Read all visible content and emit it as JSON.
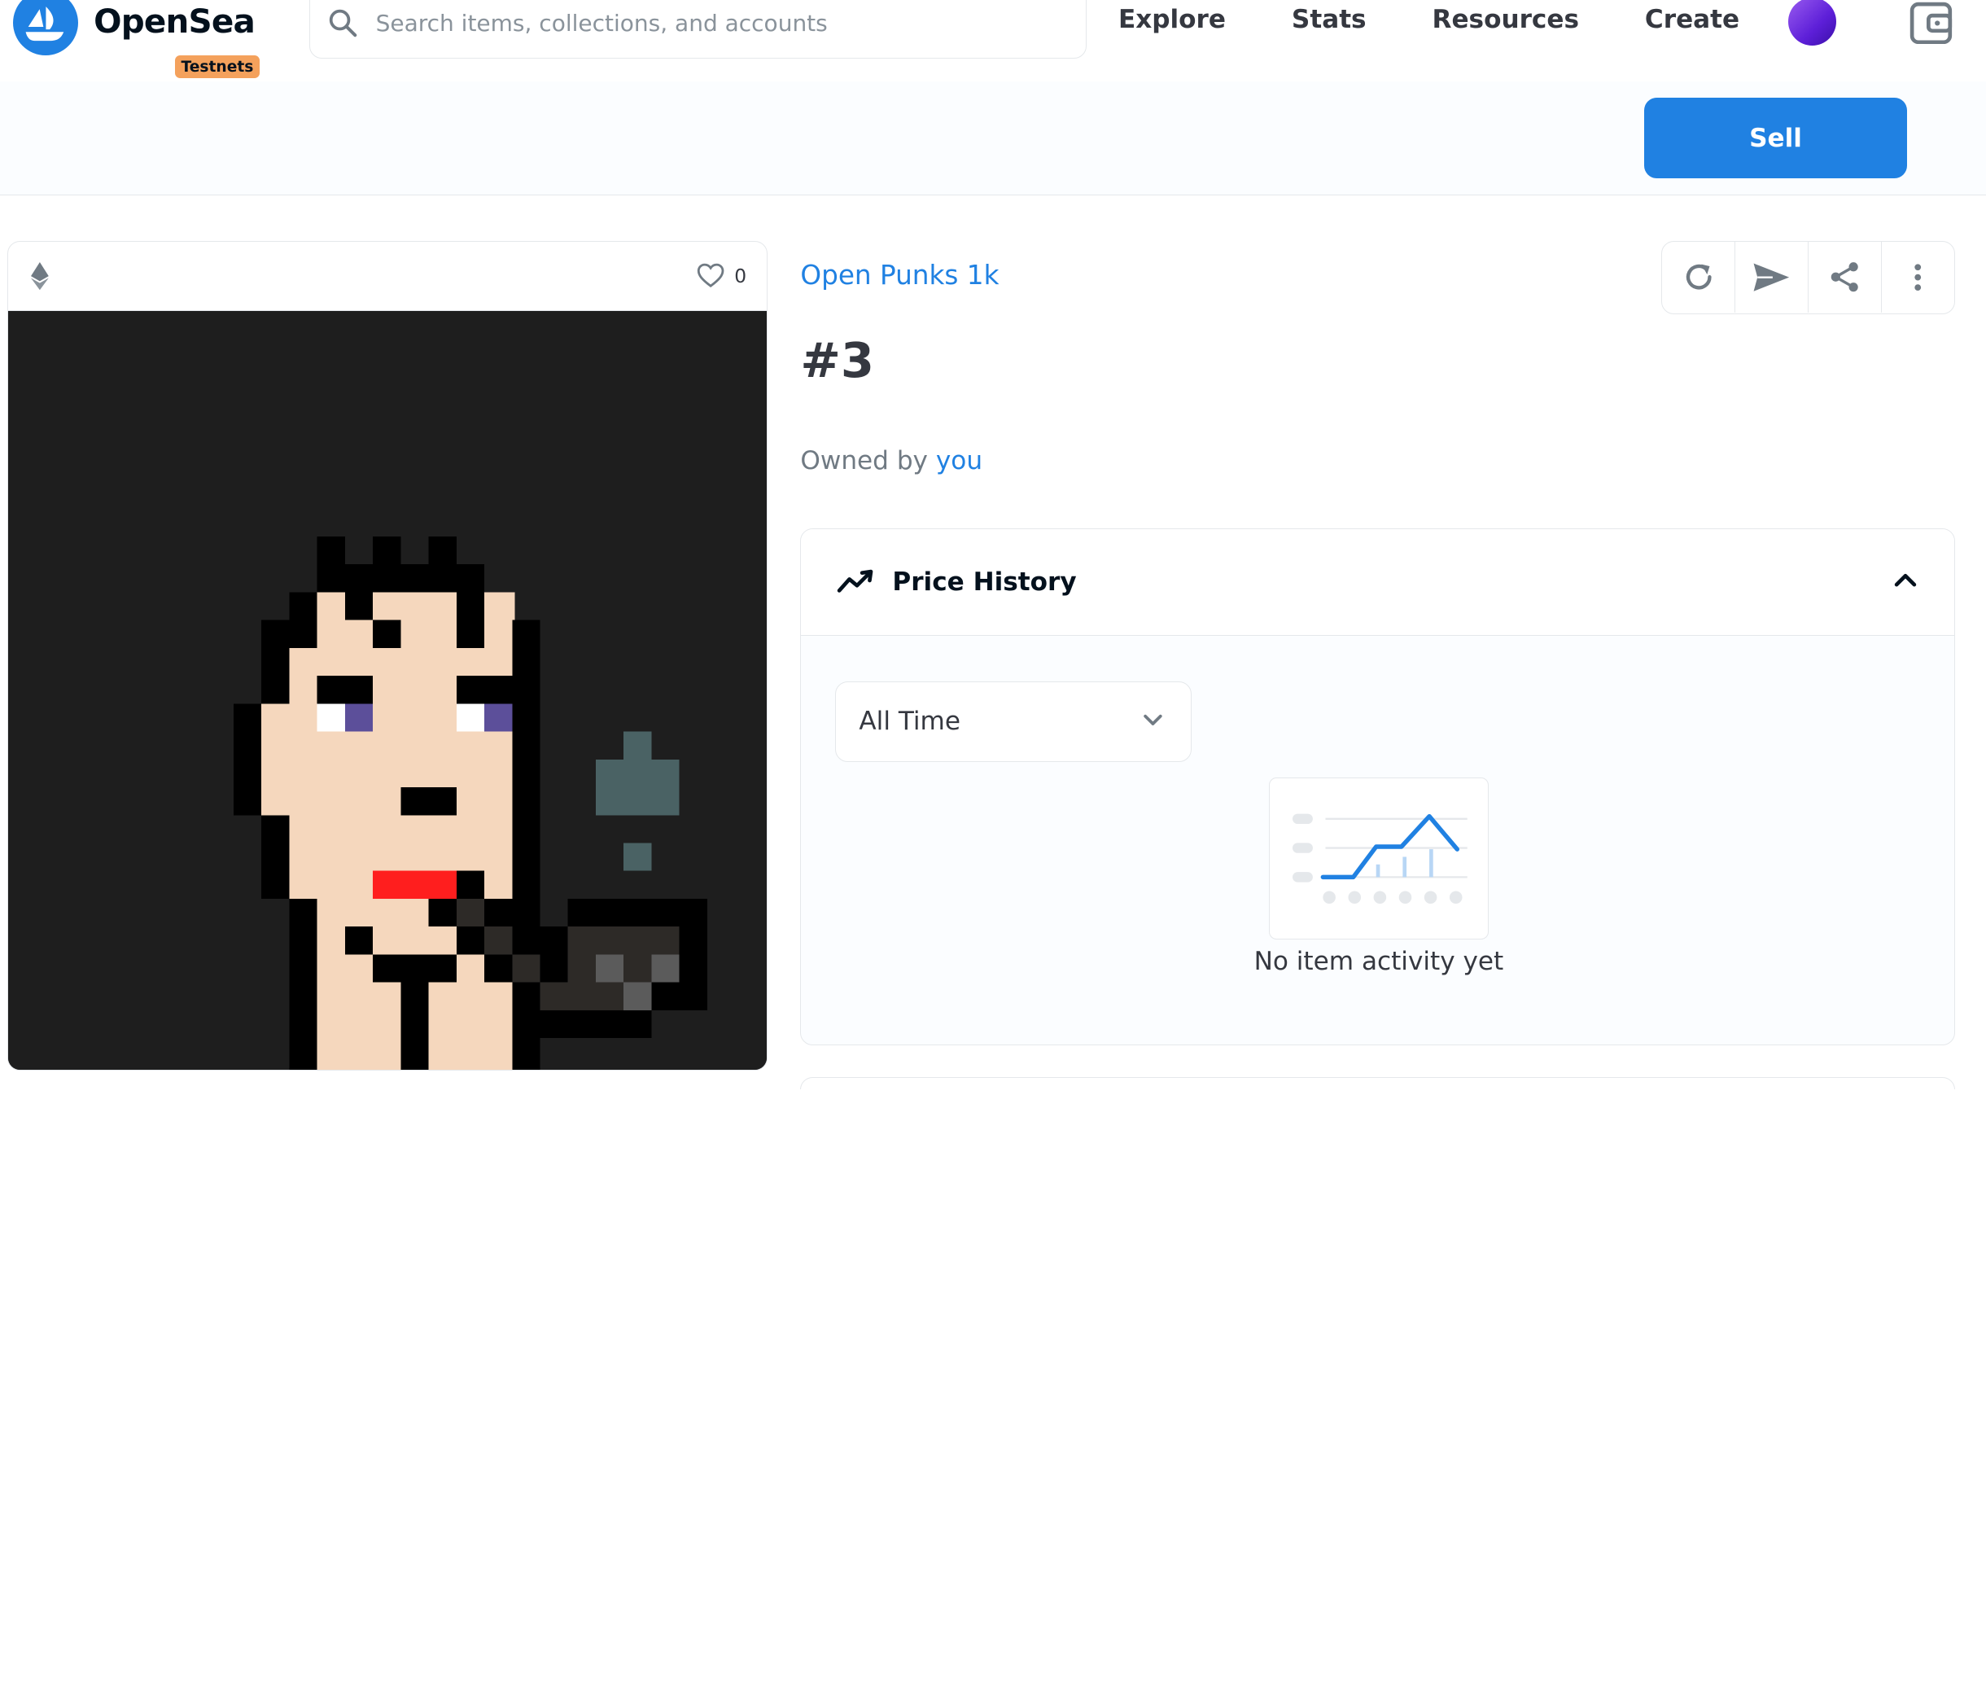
{
  "header": {
    "brand": "OpenSea",
    "badge": "Testnets",
    "search_placeholder": "Search items, collections, and accounts",
    "nav": [
      {
        "label": "Explore"
      },
      {
        "label": "Stats"
      },
      {
        "label": "Resources"
      },
      {
        "label": "Create"
      }
    ],
    "icons": [
      "opensea-logo",
      "search-icon",
      "avatar",
      "wallet-icon"
    ]
  },
  "sell_bar": {
    "sell_label": "Sell"
  },
  "item": {
    "chain_icon": "ethereum-icon",
    "favorites_count": "0",
    "collection": "Open Punks 1k",
    "title": "#3",
    "owned_prefix": "Owned by",
    "owner": "you",
    "actions": [
      "refresh-icon",
      "transfer-icon",
      "share-icon",
      "more-icon"
    ]
  },
  "price_history": {
    "title": "Price History",
    "range_selected": "All Time",
    "empty_message": "No item activity yet"
  },
  "colors": {
    "accent": "#2081e2",
    "badge": "#f4a15c",
    "image_bg": "#1e1e1e"
  }
}
